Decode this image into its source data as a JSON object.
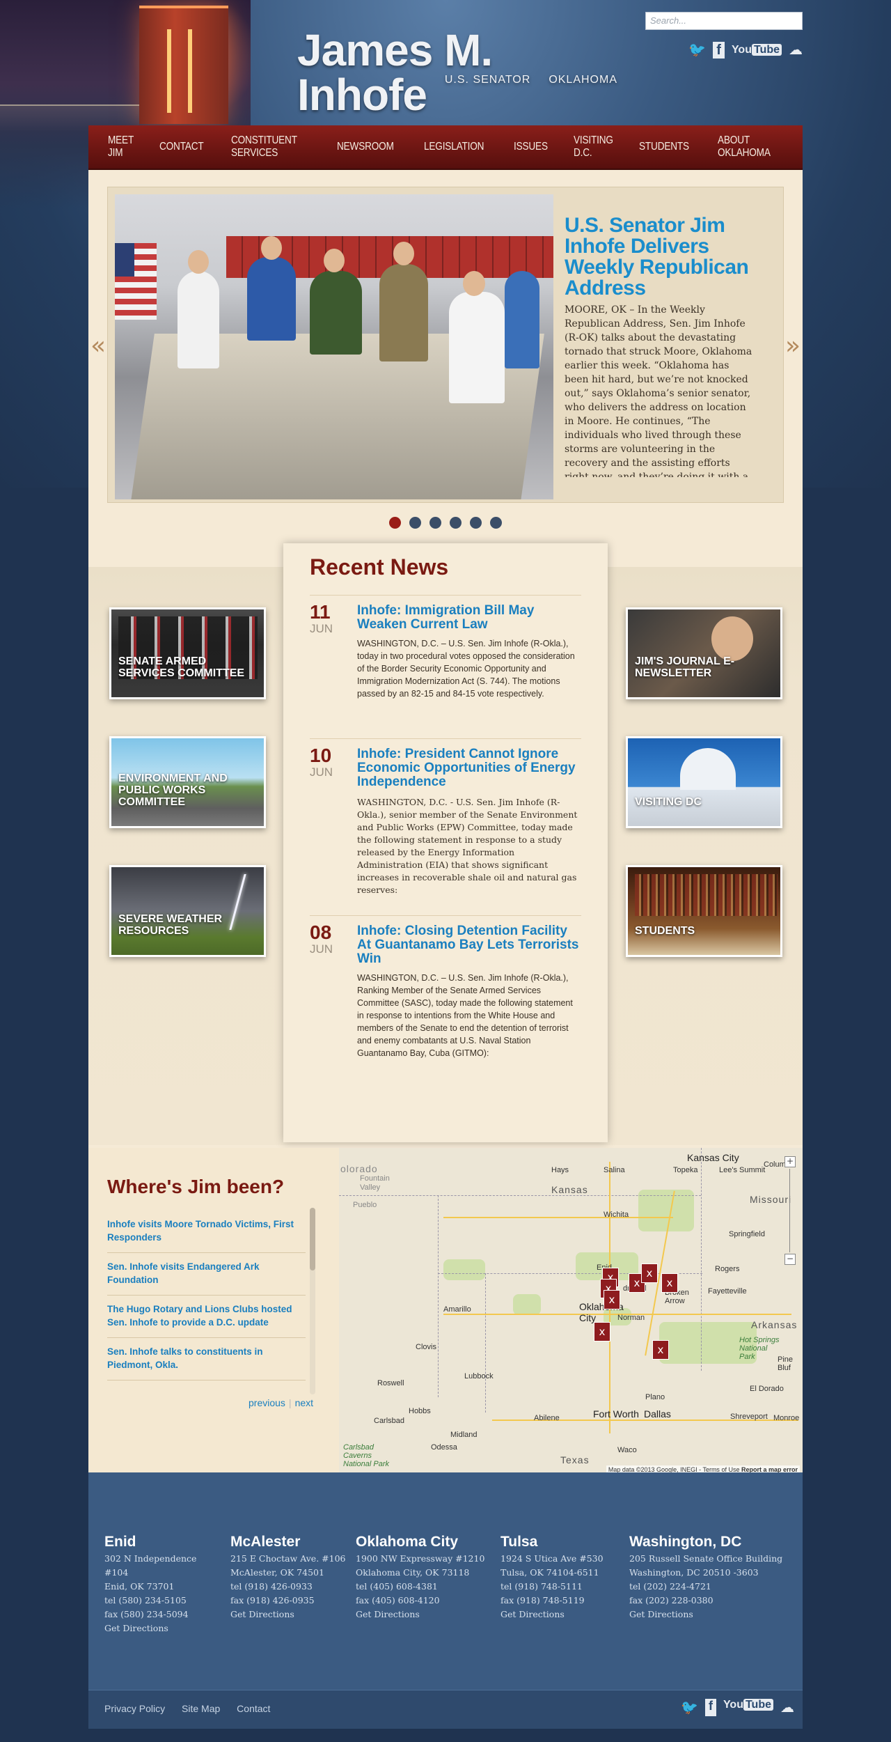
{
  "header": {
    "logo_name": "James M. Inhofe",
    "logo_title": "U.S. SENATOR",
    "logo_state": "OKLAHOMA",
    "search_placeholder": "Search..."
  },
  "social": {
    "twitter": "twitter-icon",
    "facebook": "facebook-icon",
    "youtube_you": "You",
    "youtube_tube": "Tube",
    "flickr": "flickr-icon"
  },
  "nav": [
    "MEET JIM",
    "CONTACT",
    "CONSTITUENT SERVICES",
    "NEWSROOM",
    "LEGISLATION",
    "ISSUES",
    "VISITING D.C.",
    "STUDENTS",
    "ABOUT OKLAHOMA"
  ],
  "slider": {
    "title": "U.S. Senator Jim Inhofe Delivers Weekly Republican Address",
    "body": "MOORE, OK – In the Weekly Republican Address, Sen. Jim Inhofe (R-OK) talks about the devastating tornado that struck Moore, Oklahoma earlier this week. “Oklahoma has been hit hard, but we’re not knocked out,” says Oklahoma’s senior senator, who delivers the address on location in Moore. He continues, “The individuals who lived through these storms are volunteering in the recovery and the assisting efforts right now, and they’re doing it with a smile. They are…",
    "prev": "«",
    "next": "»",
    "active_slide": 1,
    "slide_count": 6
  },
  "recent_news": {
    "heading": "Recent News",
    "items": [
      {
        "day": "11",
        "month": "JUN",
        "title": "Inhofe: Immigration Bill May Weaken Current Law",
        "body": "WASHINGTON, D.C. – U.S. Sen. Jim Inhofe (R-Okla.), today in two procedural votes opposed the consideration of the Border Security Economic Opportunity and Immigration Modernization Act (S. 744). The motions passed by an 82-15 and 84-15 vote respectively."
      },
      {
        "day": "10",
        "month": "JUN",
        "title": "Inhofe: President Cannot Ignore Economic Opportunities of Energy Independence",
        "body": "WASHINGTON, D.C. - U.S. Sen. Jim Inhofe (R-Okla.), senior member of the Senate Environment and Public Works (EPW) Committee, today made the following statement in response to a study released by the Energy Information Administration (EIA) that shows significant increases in recoverable shale oil and natural gas reserves:"
      },
      {
        "day": "08",
        "month": "JUN",
        "title": "Inhofe: Closing Detention Facility At Guantanamo Bay Lets Terrorists Win",
        "body": "WASHINGTON, D.C. – U.S. Sen. Jim Inhofe (R-Okla.), Ranking Member of the Senate Armed Services Committee (SASC), today made the following statement in response to intentions from the White House and members of the Senate to end the detention of terrorist and enemy combatants at U.S. Naval Station Guantanamo Bay, Cuba (GITMO):"
      }
    ]
  },
  "tiles": {
    "armed_services": "Senate Armed Services Committee",
    "environment": "Environment and Public Works Committee",
    "weather": "Severe Weather Resources",
    "journal": "Jim's Journal E-Newsletter",
    "visiting": "Visiting DC",
    "students": "Students"
  },
  "where": {
    "heading": "Where's Jim been?",
    "items": [
      "Inhofe visits Moore Tornado Victims, First Responders",
      "Sen. Inhofe visits Endangered Ark Foundation",
      "The Hugo Rotary and Lions Clubs hosted Sen. Inhofe to provide a D.C. update",
      "Sen. Inhofe talks to constituents in Piedmont, Okla."
    ],
    "previous": "previous",
    "separator": "|",
    "next": "next"
  },
  "map": {
    "labels": {
      "kansas_city": "Kansas City",
      "kansas": "Kansas",
      "topeka": "Topeka",
      "hays": "Hays",
      "salina": "Salina",
      "lees_summit": "Lee's Summit",
      "columbia": "Colum",
      "colorado": "olorado",
      "fountain": "Fountain",
      "valley": "Valley",
      "pueblo": "Pueblo",
      "wichita": "Wichita",
      "missouri": "Missouri",
      "springfield": "Springfield",
      "enid": "Enid",
      "rogers": "Rogers",
      "fayetteville": "Fayetteville",
      "broken_arrow": "Broken Arrow",
      "edmond": "dmond",
      "oklahoma_city": "Oklahoma City",
      "norman": "Norman",
      "amarillo": "Amarillo",
      "arkansas": "Arkansas",
      "hot_springs": "Hot Springs National Park",
      "pine_bluff": "Pine Bluf",
      "clovis": "Clovis",
      "lubbock": "Lubbock",
      "roswell": "Roswell",
      "el_dorado": "El Dorado",
      "hobbs": "Hobbs",
      "carlsbad": "Carlsbad",
      "abilene": "Abilene",
      "fort_worth": "Fort Worth",
      "dallas": "Dallas",
      "plano": "Plano",
      "shreveport": "Shreveport",
      "monroe": "Monroe",
      "midland": "Midland",
      "odessa": "Odessa",
      "caverns": "Carlsbad Caverns National Park",
      "texas": "Texas",
      "waco": "Waco"
    },
    "zoom_in": "+",
    "zoom_out": "−",
    "attribution": "Map data ©2013 Google, INEGI",
    "terms": "Terms of Use",
    "report": "Report a map error",
    "marker_icon": "x"
  },
  "offices": [
    {
      "city": "Enid",
      "lines": [
        "302 N Independence",
        "#104",
        "Enid, OK 73701",
        "tel (580) 234-5105",
        "fax (580) 234-5094",
        "Get Directions"
      ]
    },
    {
      "city": "McAlester",
      "lines": [
        "215 E Choctaw Ave. #106",
        "McAlester, OK 74501",
        "tel (918) 426-0933",
        "fax (918) 426-0935",
        "Get Directions"
      ]
    },
    {
      "city": "Oklahoma City",
      "lines": [
        "1900 NW Expressway #1210",
        "Oklahoma City, OK 73118",
        "tel (405) 608-4381",
        "fax (405) 608-4120",
        "Get Directions"
      ]
    },
    {
      "city": "Tulsa",
      "lines": [
        "1924 S Utica Ave #530",
        "Tulsa, OK 74104-6511",
        "tel (918) 748-5111",
        "fax (918) 748-5119",
        "Get Directions"
      ]
    },
    {
      "city": "Washington, DC",
      "lines": [
        "205 Russell Senate Office Building",
        "Washington, DC 20510 -3603",
        "tel (202) 224-4721",
        "fax (202) 228-0380",
        "Get Directions"
      ]
    }
  ],
  "footer_links": [
    "Privacy Policy",
    "Site Map",
    "Contact"
  ],
  "colors": {
    "nav": "#6a1512",
    "accent_blue": "#1a8dcc",
    "accent_red": "#7a1a12",
    "footer": "#3b5b82"
  }
}
